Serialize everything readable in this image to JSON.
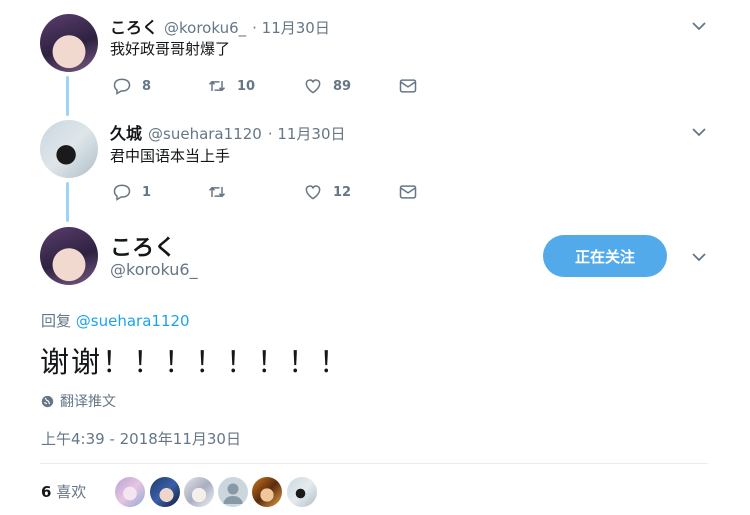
{
  "tweets": [
    {
      "display_name": "ころく",
      "handle": "@koroku6_",
      "date": "· 11月30日",
      "text": "我好政哥哥射爆了",
      "replies": "8",
      "retweets": "10",
      "likes": "89"
    },
    {
      "display_name": "久城",
      "handle": "@suehara1120",
      "date": "· 11月30日",
      "text": "君中国语本当上手",
      "replies": "1",
      "retweets": "",
      "likes": "12"
    }
  ],
  "main_tweet": {
    "display_name": "ころく",
    "handle": "@koroku6_",
    "follow_label": "正在关注",
    "reply_prefix": "回复",
    "reply_to": "@suehara1120",
    "text": "谢谢！！！！！！！！",
    "translate_label": "翻译推文",
    "timestamp": "上午4:39 - 2018年11月30日",
    "likes_count": "6",
    "likes_label": "喜欢"
  },
  "colors": {
    "accent": "#1da1f2",
    "follow_button": "#53aaeb",
    "thread_line": "#9fd3f5",
    "secondary_text": "#657786"
  },
  "icons": [
    "reply-icon",
    "retweet-icon",
    "like-icon",
    "dm-icon",
    "chevron-down-icon",
    "globe-icon"
  ]
}
